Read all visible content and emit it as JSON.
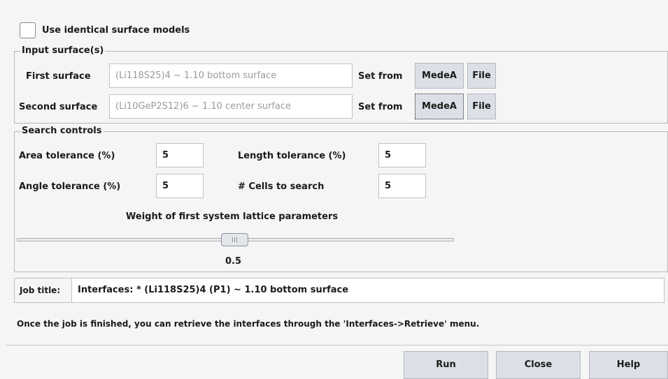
{
  "options": {
    "identical_surface_label": "Use identical surface models",
    "identical_surface_checked": false
  },
  "input_surfaces": {
    "legend": "Input surface(s)",
    "rows": [
      {
        "label": "First surface",
        "value": "(Li118S25)4 ~ 1.10 bottom surface",
        "set_from": "Set from",
        "medea": "MedeA",
        "file": "File"
      },
      {
        "label": "Second surface",
        "value": "(Li10GeP2S12)6 ~ 1.10 center surface",
        "set_from": "Set from",
        "medea": "MedeA",
        "file": "File"
      }
    ]
  },
  "search_controls": {
    "legend": "Search controls",
    "area_tolerance_label": "Area tolerance (%)",
    "area_tolerance_value": "5",
    "length_tolerance_label": "Length tolerance (%)",
    "length_tolerance_value": "5",
    "angle_tolerance_label": "Angle tolerance (%)",
    "angle_tolerance_value": "5",
    "cells_label": "# Cells to search",
    "cells_value": "5",
    "weight_label": "Weight of first system lattice parameters",
    "weight_value": "0.5",
    "weight_fraction": 0.5
  },
  "job": {
    "title_label": "Job title:",
    "title_value": "Interfaces: * (Li118S25)4  (P1) ~ 1.10 bottom surface",
    "info_text": "Once the job is finished, you can retrieve the interfaces through the 'Interfaces->Retrieve' menu."
  },
  "buttons": {
    "run": "Run",
    "close": "Close",
    "help": "Help"
  }
}
